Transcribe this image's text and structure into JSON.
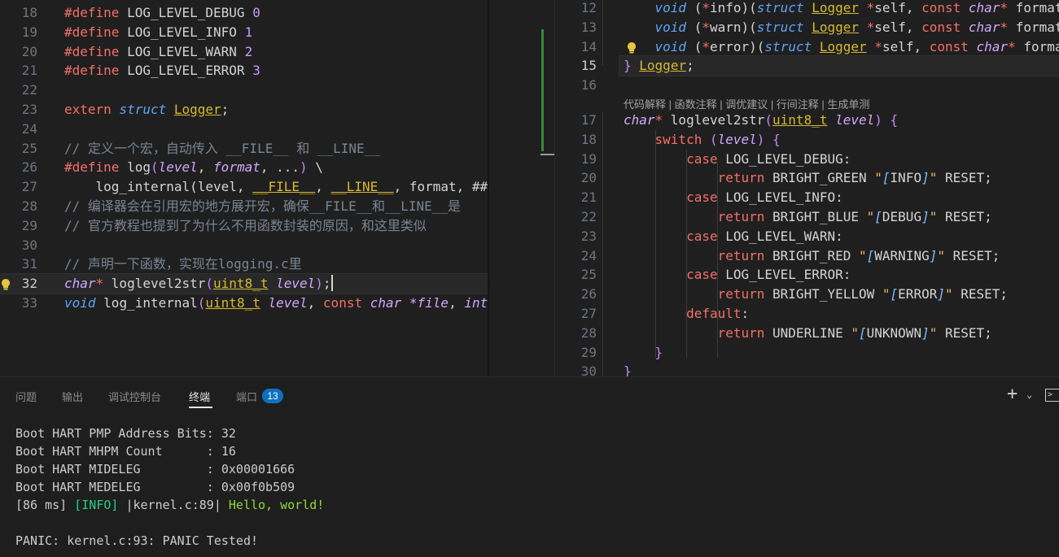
{
  "left_editor": {
    "lines": [
      {
        "num": "18",
        "tokens": [
          [
            "#define ",
            "kw"
          ],
          [
            "LOG_LEVEL_DEBUG",
            ""
          ],
          [
            " ",
            ""
          ],
          [
            "0",
            "num"
          ]
        ]
      },
      {
        "num": "19",
        "tokens": [
          [
            "#define ",
            "kw"
          ],
          [
            "LOG_LEVEL_INFO",
            ""
          ],
          [
            " ",
            ""
          ],
          [
            "1",
            "num"
          ]
        ]
      },
      {
        "num": "20",
        "tokens": [
          [
            "#define ",
            "kw"
          ],
          [
            "LOG_LEVEL_WARN",
            ""
          ],
          [
            " ",
            ""
          ],
          [
            "2",
            "num"
          ]
        ]
      },
      {
        "num": "21",
        "tokens": [
          [
            "#define ",
            "kw"
          ],
          [
            "LOG_LEVEL_ERROR",
            ""
          ],
          [
            " ",
            ""
          ],
          [
            "3",
            "num"
          ]
        ]
      },
      {
        "num": "22",
        "tokens": []
      },
      {
        "num": "23",
        "tokens": [
          [
            "extern ",
            "kw"
          ],
          [
            "struct ",
            "kw2"
          ],
          [
            "Logger",
            "ul"
          ],
          [
            ";",
            ""
          ]
        ]
      },
      {
        "num": "24",
        "tokens": []
      },
      {
        "num": "25",
        "tokens": [
          [
            "// 定义一个宏，自动传入 __FILE__ 和 __LINE__",
            "cm"
          ]
        ]
      },
      {
        "num": "26",
        "tokens": [
          [
            "#define ",
            "kw"
          ],
          [
            "log",
            ""
          ],
          [
            "(",
            "brk"
          ],
          [
            "level",
            "pm"
          ],
          [
            ", ",
            ""
          ],
          [
            "format",
            "pm"
          ],
          [
            ", ...",
            ""
          ],
          [
            ")",
            "brk"
          ],
          [
            " \\",
            ""
          ]
        ]
      },
      {
        "num": "27",
        "tokens": [
          [
            "    log_internal(level, ",
            ""
          ],
          [
            "__FILE__",
            "ul"
          ],
          [
            ", ",
            ""
          ],
          [
            "__LINE__",
            "ul"
          ],
          [
            ", format, ##",
            ""
          ]
        ]
      },
      {
        "num": "28",
        "tokens": [
          [
            "// 编译器会在引用宏的地方展开宏，确保__FILE__和__LINE__是",
            "cm"
          ]
        ]
      },
      {
        "num": "29",
        "tokens": [
          [
            "// 官方教程也提到了为什么不用函数封装的原因，和这里类似",
            "cm"
          ]
        ]
      },
      {
        "num": "30",
        "tokens": []
      },
      {
        "num": "31",
        "tokens": [
          [
            "// 声明一下函数，实现在logging.c里",
            "cm"
          ]
        ]
      },
      {
        "num": "32",
        "tokens": [
          [
            "char",
            "typ"
          ],
          [
            "* ",
            "kw"
          ],
          [
            "loglevel2str",
            ""
          ],
          [
            "(",
            "brk"
          ],
          [
            "uint8_t",
            "ul"
          ],
          [
            " ",
            ""
          ],
          [
            "level",
            "pm"
          ],
          [
            ")",
            "brk"
          ],
          [
            ";",
            ""
          ]
        ],
        "current": true,
        "bulb": true
      },
      {
        "num": "33",
        "tokens": [
          [
            "void ",
            "kw2"
          ],
          [
            "log_internal",
            ""
          ],
          [
            "(",
            "brk"
          ],
          [
            "uint8_t",
            "ul"
          ],
          [
            " ",
            ""
          ],
          [
            "level",
            "pm"
          ],
          [
            ", ",
            ""
          ],
          [
            "const ",
            "kw"
          ],
          [
            "char ",
            "typ"
          ],
          [
            "*file",
            "pm"
          ],
          [
            ", ",
            ""
          ],
          [
            "int",
            "typ"
          ]
        ]
      }
    ]
  },
  "right_editor": {
    "lines": [
      {
        "num": "12",
        "tokens": [
          [
            "    void ",
            "kw2"
          ],
          [
            "(",
            ""
          ],
          [
            "*",
            "kw"
          ],
          [
            "info",
            ""
          ],
          [
            ")(",
            ""
          ],
          [
            "struct ",
            "kw2"
          ],
          [
            "Logger",
            "ul"
          ],
          [
            " ",
            ""
          ],
          [
            "*",
            "kw"
          ],
          [
            "self, ",
            ""
          ],
          [
            "const ",
            "kw"
          ],
          [
            "char",
            "typ"
          ],
          [
            "* ",
            "kw"
          ],
          [
            "format",
            ""
          ]
        ]
      },
      {
        "num": "13",
        "tokens": [
          [
            "    void ",
            "kw2"
          ],
          [
            "(",
            ""
          ],
          [
            "*",
            "kw"
          ],
          [
            "warn",
            ""
          ],
          [
            ")(",
            ""
          ],
          [
            "struct ",
            "kw2"
          ],
          [
            "Logger",
            "ul"
          ],
          [
            " ",
            ""
          ],
          [
            "*",
            "kw"
          ],
          [
            "self, ",
            ""
          ],
          [
            "const ",
            "kw"
          ],
          [
            "char",
            "typ"
          ],
          [
            "* ",
            "kw"
          ],
          [
            "format",
            ""
          ]
        ]
      },
      {
        "num": "14",
        "tokens": [
          [
            "    void ",
            "kw2"
          ],
          [
            "(",
            ""
          ],
          [
            "*",
            "kw"
          ],
          [
            "error",
            ""
          ],
          [
            ")(",
            ""
          ],
          [
            "struct ",
            "kw2"
          ],
          [
            "Logger",
            "ul"
          ],
          [
            " ",
            ""
          ],
          [
            "*",
            "kw"
          ],
          [
            "self, ",
            ""
          ],
          [
            "const ",
            "kw"
          ],
          [
            "char",
            "typ"
          ],
          [
            "* ",
            "kw"
          ],
          [
            "forma",
            ""
          ]
        ],
        "bulb": true
      },
      {
        "num": "15",
        "tokens": [
          [
            "}",
            "brk"
          ],
          [
            " ",
            ""
          ],
          [
            "Logger",
            "ul"
          ],
          [
            ";",
            ""
          ]
        ],
        "current": true
      },
      {
        "num": "16",
        "tokens": []
      },
      {
        "num": "17",
        "tokens": [
          [
            "char",
            "typ"
          ],
          [
            "* ",
            "kw"
          ],
          [
            "loglevel2str",
            ""
          ],
          [
            "(",
            "brk"
          ],
          [
            "uint8_t",
            "ul"
          ],
          [
            " ",
            ""
          ],
          [
            "level",
            "pm"
          ],
          [
            ") ",
            "brk"
          ],
          [
            "{",
            "brk"
          ]
        ]
      },
      {
        "num": "18",
        "tokens": [
          [
            "    switch ",
            "kw"
          ],
          [
            "(",
            "brk"
          ],
          [
            "level",
            "pm"
          ],
          [
            ") ",
            "brk"
          ],
          [
            "{",
            "brk"
          ]
        ]
      },
      {
        "num": "19",
        "tokens": [
          [
            "        case ",
            "kw"
          ],
          [
            "LOG_LEVEL_DEBUG:",
            ""
          ]
        ]
      },
      {
        "num": "20",
        "tokens": [
          [
            "            return ",
            "kw"
          ],
          [
            "BRIGHT_GREEN ",
            ""
          ],
          [
            "\"",
            "str"
          ],
          [
            "[",
            "ty2"
          ],
          [
            "INFO",
            ""
          ],
          [
            "]",
            "ty2"
          ],
          [
            "\"",
            "str"
          ],
          [
            " RESET;",
            ""
          ]
        ]
      },
      {
        "num": "21",
        "tokens": [
          [
            "        case ",
            "kw"
          ],
          [
            "LOG_LEVEL_INFO:",
            ""
          ]
        ]
      },
      {
        "num": "22",
        "tokens": [
          [
            "            return ",
            "kw"
          ],
          [
            "BRIGHT_BLUE ",
            ""
          ],
          [
            "\"",
            "str"
          ],
          [
            "[",
            "ty2"
          ],
          [
            "DEBUG",
            ""
          ],
          [
            "]",
            "ty2"
          ],
          [
            "\"",
            "str"
          ],
          [
            " RESET;",
            ""
          ]
        ]
      },
      {
        "num": "23",
        "tokens": [
          [
            "        case ",
            "kw"
          ],
          [
            "LOG_LEVEL_WARN:",
            ""
          ]
        ]
      },
      {
        "num": "24",
        "tokens": [
          [
            "            return ",
            "kw"
          ],
          [
            "BRIGHT_RED ",
            ""
          ],
          [
            "\"",
            "str"
          ],
          [
            "[",
            "ty2"
          ],
          [
            "WARNING",
            ""
          ],
          [
            "]",
            "ty2"
          ],
          [
            "\"",
            "str"
          ],
          [
            " RESET;",
            ""
          ]
        ]
      },
      {
        "num": "25",
        "tokens": [
          [
            "        case ",
            "kw"
          ],
          [
            "LOG_LEVEL_ERROR:",
            ""
          ]
        ]
      },
      {
        "num": "26",
        "tokens": [
          [
            "            return ",
            "kw"
          ],
          [
            "BRIGHT_YELLOW ",
            ""
          ],
          [
            "\"",
            "str"
          ],
          [
            "[",
            "ty2"
          ],
          [
            "ERROR",
            ""
          ],
          [
            "]",
            "ty2"
          ],
          [
            "\"",
            "str"
          ],
          [
            " RESET;",
            ""
          ]
        ]
      },
      {
        "num": "27",
        "tokens": [
          [
            "        default",
            "kw"
          ],
          [
            ":",
            ""
          ]
        ]
      },
      {
        "num": "28",
        "tokens": [
          [
            "            return ",
            "kw"
          ],
          [
            "UNDERLINE ",
            ""
          ],
          [
            "\"",
            "str"
          ],
          [
            "[",
            "ty2"
          ],
          [
            "UNKNOWN",
            ""
          ],
          [
            "]",
            "ty2"
          ],
          [
            "\"",
            "str"
          ],
          [
            " RESET;",
            ""
          ]
        ]
      },
      {
        "num": "29",
        "tokens": [
          [
            "    }",
            "brk"
          ]
        ]
      },
      {
        "num": "30",
        "tokens": [
          [
            "}",
            "brk"
          ]
        ]
      }
    ],
    "codelens": "代码解释 | 函数注释 | 调优建议 | 行间注释 | 生成单测"
  },
  "panel": {
    "tabs": [
      "问题",
      "输出",
      "调试控制台",
      "终端",
      "端口"
    ],
    "active_tab": "终端",
    "ports_badge": "13",
    "terminal": {
      "line1": "Boot HART PMP Address Bits: 32",
      "line2": "Boot HART MHPM Count      : 16",
      "line3": "Boot HART MIDELEG         : 0x00001666",
      "line4": "Boot HART MEDELEG         : 0x00f0b509",
      "line5": {
        "time": "[86 ms] ",
        "level": "[INFO]",
        "pos": " |kernel.c:89| ",
        "msg": "Hello, world!"
      },
      "line7": "PANIC: kernel.c:93: PANIC Tested!"
    }
  },
  "colors": {
    "bg": "#1f1f1f",
    "accent": "#0e70c0"
  }
}
